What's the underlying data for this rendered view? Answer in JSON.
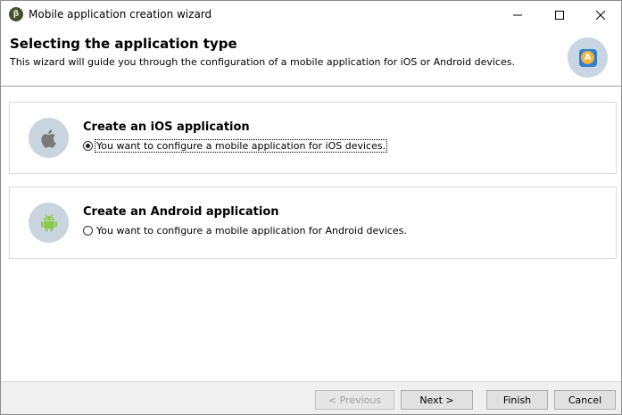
{
  "window": {
    "title": "Mobile application creation wizard",
    "app_icon_glyph": "β"
  },
  "header": {
    "title": "Selecting the application type",
    "subtitle": "This wizard will guide you through the configuration of a mobile application for iOS or Android devices.",
    "logo_glyph": "A"
  },
  "options": [
    {
      "title": "Create an iOS application",
      "label": "You want to configure a mobile application for iOS devices.",
      "selected": true,
      "icon": "apple-icon"
    },
    {
      "title": "Create an Android application",
      "label": "You want to configure a mobile application for Android devices.",
      "selected": false,
      "icon": "android-icon"
    }
  ],
  "footer": {
    "previous_label": "< Previous",
    "next_label": "Next >",
    "finish_label": "Finish",
    "cancel_label": "Cancel"
  },
  "colors": {
    "header_logo_bg": "#c7d6e2",
    "card_icon_bg": "#c8d5df",
    "android_green": "#8cc84b",
    "apple_gray": "#7a7a7a",
    "footer_bg": "#f0f0f0"
  }
}
